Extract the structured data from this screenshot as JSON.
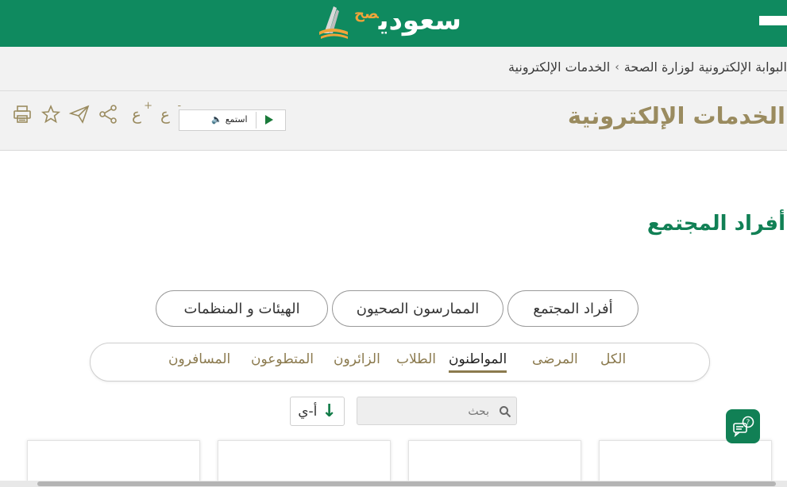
{
  "header": {
    "logo_text": "سعودي",
    "logo_sub": "صح",
    "brand_color": "#0f8a5f"
  },
  "breadcrumb": {
    "items": [
      "البوابة الإلكترونية لوزارة الصحة",
      "الخدمات الإلكترونية"
    ],
    "separator": "›"
  },
  "title_bar": {
    "title": "الخدمات الإلكترونية",
    "listen_label": "استمع",
    "font_decrease": "ع",
    "font_increase": "ع",
    "tool_icons": [
      "print-icon",
      "star-icon",
      "send-icon",
      "share-icon",
      "font-increase-icon",
      "font-decrease-icon"
    ]
  },
  "section": {
    "title": "أفراد المجتمع"
  },
  "categories": [
    {
      "label": "أفراد المجتمع"
    },
    {
      "label": "الممارسون الصحيون"
    },
    {
      "label": "الهيئات و المنظمات"
    }
  ],
  "filters": {
    "tabs": [
      {
        "label": "الكل",
        "active": false
      },
      {
        "label": "المرضى",
        "active": false
      },
      {
        "label": "المواطنون",
        "active": true
      },
      {
        "label": "الطلاب",
        "active": false
      },
      {
        "label": "الزائرون",
        "active": false
      },
      {
        "label": "المتطوعون",
        "active": false
      },
      {
        "label": "المسافرون",
        "active": false
      }
    ]
  },
  "search": {
    "placeholder": "بحث"
  },
  "sort": {
    "label": "أ-ي"
  },
  "colors": {
    "accent_green": "#118055",
    "gold": "#9a8b5f"
  }
}
